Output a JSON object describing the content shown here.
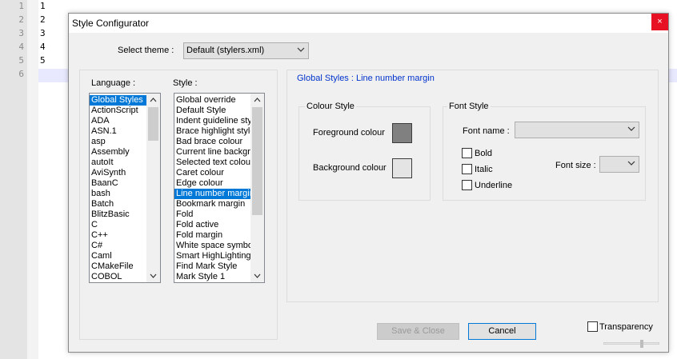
{
  "editor": {
    "line_numbers": [
      "1",
      "2",
      "3",
      "4",
      "5",
      "6"
    ],
    "lines": [
      "1",
      "2",
      "3",
      "4",
      "5",
      ""
    ]
  },
  "dialog": {
    "title": "Style Configurator",
    "close_glyph": "×",
    "select_theme_label": "Select theme :",
    "theme_value": "Default (stylers.xml)",
    "language_label": "Language :",
    "style_label": "Style :",
    "languages": [
      "Global Styles",
      "ActionScript",
      "ADA",
      "ASN.1",
      "asp",
      "Assembly",
      "autoIt",
      "AviSynth",
      "BaanC",
      "bash",
      "Batch",
      "BlitzBasic",
      "C",
      "C++",
      "C#",
      "Caml",
      "CMakeFile",
      "COBOL"
    ],
    "selected_language": "Global Styles",
    "styles": [
      "Global override",
      "Default Style",
      "Indent guideline style",
      "Brace highlight style",
      "Bad brace colour",
      "Current line background",
      "Selected text colour",
      "Caret colour",
      "Edge colour",
      "Line number margin",
      "Bookmark margin",
      "Fold",
      "Fold active",
      "Fold margin",
      "White space symbol",
      "Smart HighLighting",
      "Find Mark Style",
      "Mark Style 1"
    ],
    "selected_style": "Line number margin",
    "section_title": "Global Styles : Line number margin",
    "colour_style": {
      "title": "Colour Style",
      "foreground_label": "Foreground colour",
      "background_label": "Background colour",
      "foreground_color": "#808080",
      "background_color": "#e4e4e4"
    },
    "font_style": {
      "title": "Font Style",
      "font_name_label": "Font name :",
      "font_name_value": "",
      "bold_label": "Bold",
      "italic_label": "Italic",
      "underline_label": "Underline",
      "font_size_label": "Font size :",
      "font_size_value": ""
    },
    "save_close_label": "Save & Close",
    "cancel_label": "Cancel",
    "transparency_label": "Transparency",
    "accent_color": "#0078d7",
    "title_link_color": "#0033cc"
  }
}
